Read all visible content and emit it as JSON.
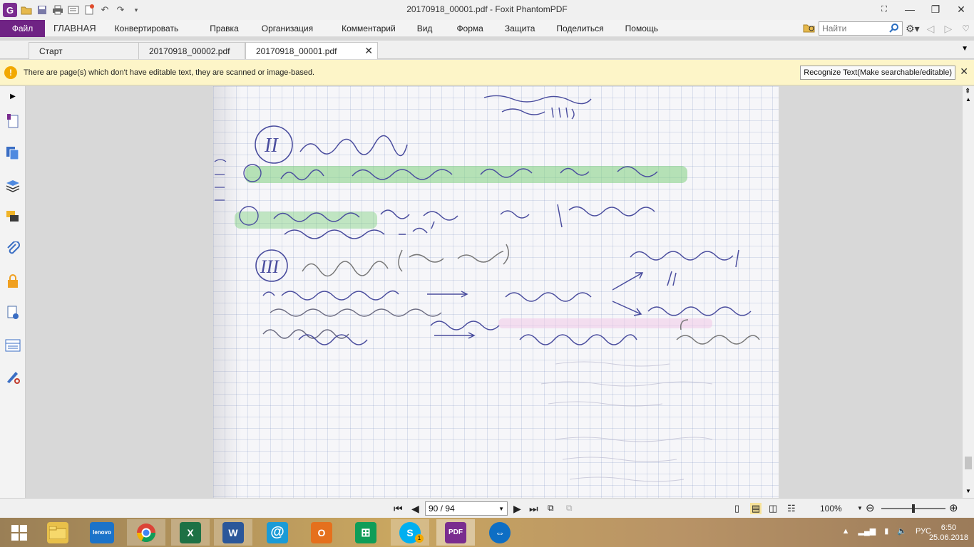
{
  "window": {
    "title": "20170918_00001.pdf - Foxit PhantomPDF"
  },
  "menu": {
    "file": "Файл",
    "items": [
      "ГЛАВНАЯ",
      "Конвертировать",
      "Правка",
      "Организация",
      "Комментарий",
      "Вид",
      "Форма",
      "Защита",
      "Поделиться",
      "Помощь"
    ],
    "search_placeholder": "Найти"
  },
  "tabs": [
    {
      "label": "Старт"
    },
    {
      "label": "20170918_00002.pdf"
    },
    {
      "label": "20170918_00001.pdf"
    }
  ],
  "notice": {
    "message": "There are page(s) which don't have editable text, they are scanned or image-based.",
    "button": "Recognize Text(Make searchable/editable)"
  },
  "navigation": {
    "page_indicator": "90 / 94",
    "zoom": "100%"
  },
  "taskbar": {
    "language": "РУС",
    "time": "6:50",
    "date": "25.06.2018",
    "apps": [
      "windows-start",
      "file-explorer",
      "lenovo",
      "chrome",
      "excel",
      "word",
      "mail",
      "outlook",
      "store",
      "skype",
      "foxit-pdf",
      "teamviewer"
    ],
    "skype_badge": "1"
  },
  "colors": {
    "brand": "#6f2384",
    "notice_bg": "#fdf5c8",
    "ink": "#4a4d9e",
    "highlight": "#7fd07f"
  }
}
